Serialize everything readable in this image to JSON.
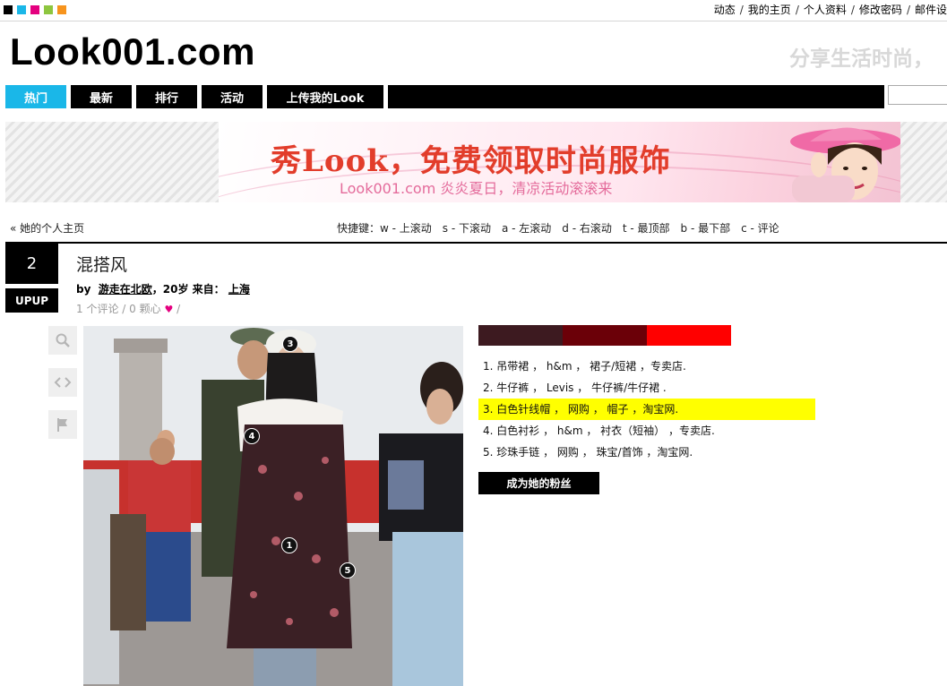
{
  "colors": {
    "accent": "#1ab7e8",
    "nav_bg": "#000000",
    "highlight": "#ffff00",
    "heart": "#e4007f",
    "squares": [
      "#000000",
      "#1ab7e8",
      "#e4007f",
      "#8dc63f",
      "#f7941d"
    ]
  },
  "top_links": [
    "动态",
    "我的主页",
    "个人资料",
    "修改密码",
    "邮件设"
  ],
  "logo": "Look001.com",
  "slogan": "分享生活时尚，",
  "nav": {
    "items": [
      "热门",
      "最新",
      "排行",
      "活动",
      "上传我的Look"
    ],
    "active_index": 0,
    "search_value": ""
  },
  "banner": {
    "title": "秀Look，免费领取时尚服饰",
    "subtitle": "Look001.com 炎炎夏日，清凉活动滚滚来"
  },
  "subnav": {
    "back_link": "« 她的个人主页",
    "shortcuts": "快捷键：w - 上滚动　s - 下滚动　a - 左滚动　d - 右滚动　t - 最顶部　b - 最下部　c - 评论"
  },
  "post": {
    "rank": "2",
    "upup_label": "UPUP",
    "title": "混搭风",
    "by_prefix": "by",
    "author": "游走在北欧",
    "age_from": "，20岁 来自：",
    "location": "上海",
    "comments": "1 个评论",
    "meta_sep": "/",
    "hearts": "0 颗心",
    "meta_tail": "/"
  },
  "tools": [
    "search-icon",
    "share-code-icon",
    "flag-icon"
  ],
  "markers": [
    "1",
    "3",
    "4",
    "5"
  ],
  "swatches": [
    "#3d1a20",
    "#6b0008",
    "#ff0000"
  ],
  "items": [
    "1. 吊带裙 ， h&m ， 裙子/短裙 ，专卖店.",
    "2. 牛仔裤 ， Levis ， 牛仔裤/牛仔裙 .",
    "3. 白色针线帽 ， 网购 ， 帽子 ，淘宝网.",
    "4. 白色衬衫 ， h&m ， 衬衣（短袖） ，专卖店.",
    "5. 珍珠手链 ， 网购 ， 珠宝/首饰 ，淘宝网."
  ],
  "highlighted_item": 2,
  "fan_button": "成为她的粉丝"
}
